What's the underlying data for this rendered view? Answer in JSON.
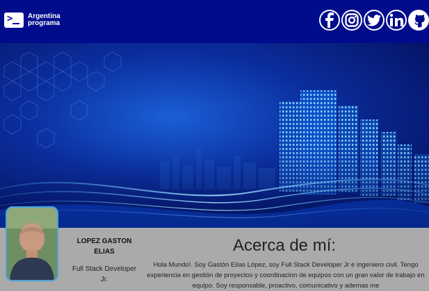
{
  "navbar": {
    "logo_line1": "Argentina",
    "logo_line2": "programa",
    "background": "#000c8c",
    "social_icons": [
      "facebook-icon",
      "instagram-icon",
      "twitter-icon",
      "linkedin-icon",
      "github-icon"
    ]
  },
  "profile": {
    "name": "LOPEZ GASTON ELIAS",
    "role": "Full Stack Developer Jr."
  },
  "about": {
    "title": "Acerca de mí:",
    "text": "Hola Mundo!. Soy Gastón Elías López, soy Full Stack Developer Jr e ingeniero civil. Tengo experiencia en gestión de proyectos y coordinacion de equipos con un gran valor de trabajo en equipo. Soy responsable, proactivo, comunicativo y ademas me"
  }
}
